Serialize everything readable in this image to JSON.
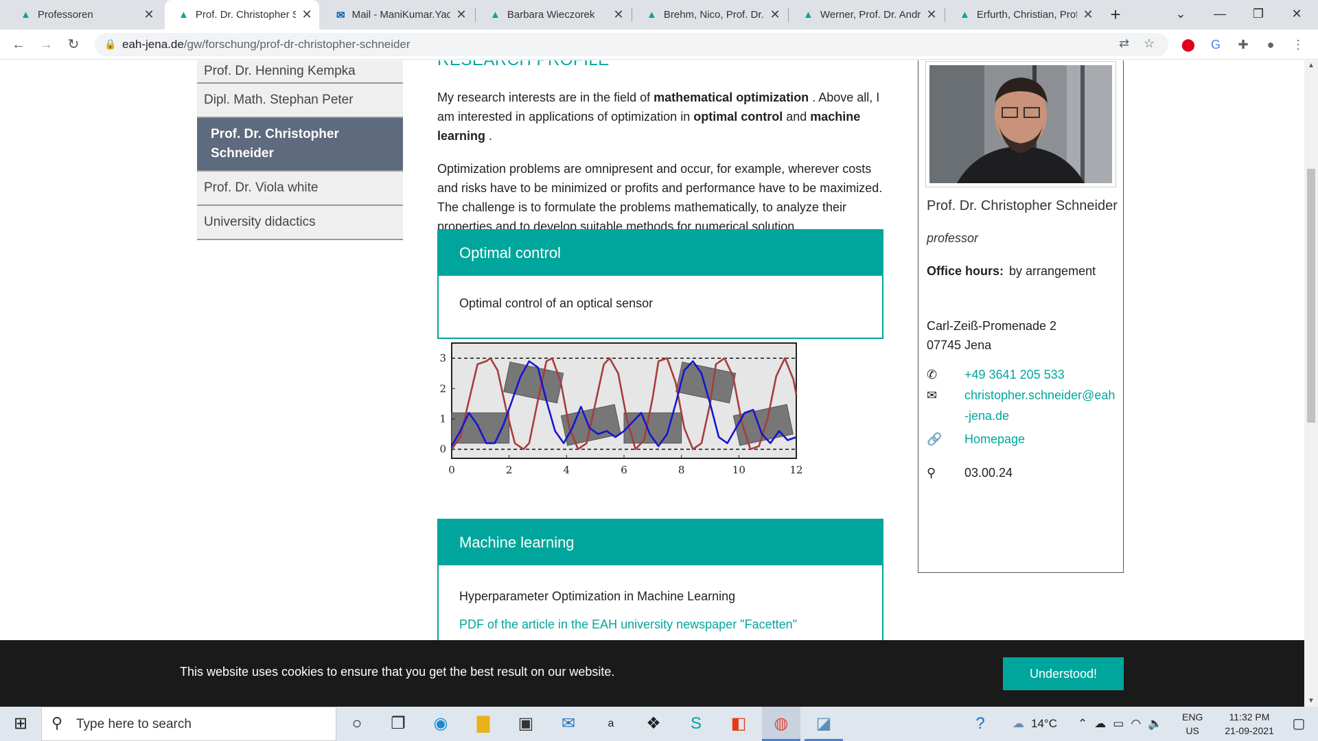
{
  "browser": {
    "tabs": [
      {
        "title": "Professoren",
        "active": false
      },
      {
        "title": "Prof. Dr. Christopher Schneider",
        "active": true
      },
      {
        "title": "Mail - ManiKumar.Yadav",
        "active": false
      },
      {
        "title": "Barbara Wieczorek",
        "active": false
      },
      {
        "title": "Brehm, Nico, Prof. Dr.",
        "active": false
      },
      {
        "title": "Werner, Prof. Dr. Andreas",
        "active": false
      },
      {
        "title": "Erfurth, Christian, Prof. Dr.",
        "active": false
      }
    ],
    "url_host": "eah-jena.de",
    "url_path": "/gw/forschung/prof-dr-christopher-schneider"
  },
  "sidenav": {
    "items": [
      {
        "label": "Prof. Dr. Henning Kempka"
      },
      {
        "label": "Dipl. Math. Stephan Peter"
      },
      {
        "label": "Prof. Dr. Christopher Schneider"
      },
      {
        "label": "Prof. Dr. Viola white"
      },
      {
        "label": "University didactics"
      }
    ]
  },
  "content": {
    "heading": "RESEARCH PROFILE",
    "p1_a": "My research interests are in the field of ",
    "p1_b": "mathematical optimization",
    "p1_c": " . Above all, I am interested in applications of optimization in ",
    "p1_d": "optimal control",
    "p1_e": " and  ",
    "p1_f": "machine learning",
    "p1_g": " .",
    "p2": "Optimization problems are omnipresent and occur, for example, wherever costs and risks have to be minimized or profits and performance have to be maximized. The challenge is to formulate the problems mathematically, to analyze their properties and to develop suitable methods for numerical solution.",
    "box1_title": "Optimal control",
    "box1_text": "Optimal control of an optical sensor",
    "box2_title": "Machine learning",
    "box2_text": "Hyperparameter Optimization in Machine Learning",
    "box2_link": "PDF of the article in the EAH university newspaper \"Facetten\""
  },
  "chart_data": {
    "type": "line",
    "title": "",
    "xlabel": "",
    "ylabel": "",
    "xlim": [
      0,
      12
    ],
    "ylim": [
      -0.3,
      3.5
    ],
    "xticks": [
      0,
      2,
      4,
      6,
      8,
      10,
      12
    ],
    "yticks": [
      0,
      1,
      2,
      3
    ],
    "bounds": [
      0,
      3
    ],
    "series": [
      {
        "color": "#a83c3c",
        "x": [
          0,
          0.3,
          0.6,
          0.9,
          1.2,
          1.35,
          1.6,
          1.9,
          2.2,
          2.5,
          2.7,
          3.0,
          3.3,
          3.5,
          3.8,
          4.1,
          4.4,
          4.7,
          5.0,
          5.3,
          5.5,
          5.8,
          6.1,
          6.4,
          6.7,
          7.0,
          7.2,
          7.5,
          7.8,
          8.1,
          8.4,
          8.7,
          9.0,
          9.2,
          9.5,
          9.8,
          10.1,
          10.4,
          10.7,
          11.0,
          11.3,
          11.6,
          11.9,
          12
        ],
        "y": [
          0,
          0.4,
          1.6,
          2.8,
          2.9,
          3.0,
          2.6,
          1.3,
          0.2,
          0.0,
          0.2,
          1.6,
          2.9,
          3.0,
          2.2,
          0.7,
          0.0,
          0.2,
          1.5,
          2.8,
          3.0,
          2.5,
          1.0,
          0.0,
          0.3,
          1.7,
          2.9,
          3.0,
          2.2,
          0.7,
          0.0,
          0.2,
          1.5,
          2.8,
          3.0,
          2.4,
          0.9,
          0.0,
          0.1,
          1.0,
          2.4,
          3.0,
          2.3,
          1.8
        ]
      },
      {
        "color": "#1515d0",
        "x": [
          0,
          0.3,
          0.6,
          0.9,
          1.2,
          1.5,
          1.8,
          2.1,
          2.4,
          2.7,
          3.0,
          3.3,
          3.6,
          3.9,
          4.2,
          4.5,
          4.8,
          5.1,
          5.4,
          5.7,
          6.0,
          6.3,
          6.6,
          6.9,
          7.2,
          7.5,
          7.8,
          8.1,
          8.4,
          8.7,
          9.0,
          9.3,
          9.6,
          9.9,
          10.2,
          10.5,
          10.8,
          11.1,
          11.4,
          11.7,
          12
        ],
        "y": [
          0.1,
          0.6,
          1.2,
          0.8,
          0.2,
          0.2,
          0.8,
          1.6,
          2.4,
          2.9,
          2.7,
          1.6,
          0.6,
          0.2,
          0.7,
          1.4,
          0.7,
          0.5,
          0.6,
          0.4,
          0.6,
          0.9,
          1.2,
          0.5,
          0.1,
          0.5,
          1.5,
          2.6,
          2.9,
          2.5,
          1.5,
          0.4,
          0.2,
          0.7,
          1.2,
          1.3,
          0.5,
          0.2,
          0.6,
          0.3,
          0.4
        ]
      }
    ],
    "rects": [
      {
        "x": 0,
        "y": 0.2,
        "w": 2,
        "h": 1.0,
        "angle": 0
      },
      {
        "x": 1.9,
        "y": 1.7,
        "w": 1.9,
        "h": 1.0,
        "angle": -12
      },
      {
        "x": 3.9,
        "y": 0.3,
        "w": 1.9,
        "h": 1.0,
        "angle": 12
      },
      {
        "x": 6.0,
        "y": 0.2,
        "w": 2,
        "h": 1.0,
        "angle": 0
      },
      {
        "x": 7.9,
        "y": 1.7,
        "w": 1.9,
        "h": 1.0,
        "angle": -12
      },
      {
        "x": 9.9,
        "y": 0.3,
        "w": 1.9,
        "h": 1.0,
        "angle": 12
      }
    ]
  },
  "profile": {
    "name": "Prof. Dr. Christopher Schneider",
    "role": "professor",
    "office_label": "Office hours:",
    "office_value": "by arrangement",
    "street": "Carl-Zeiß-Promenade 2",
    "city": "07745   Jena",
    "phone": "+49 3641 205 533",
    "email": "christopher.schneider@eah-jena.de",
    "homepage": "Homepage",
    "room": "03.00.24"
  },
  "cookie": {
    "message": "This website uses cookies to ensure that you get the best result on our website.",
    "button": "Understood!"
  },
  "taskbar": {
    "search_placeholder": "Type here to search",
    "weather": "14°C",
    "lang1": "ENG",
    "lang2": "US",
    "time": "11:32 PM",
    "date": "21-09-2021"
  }
}
